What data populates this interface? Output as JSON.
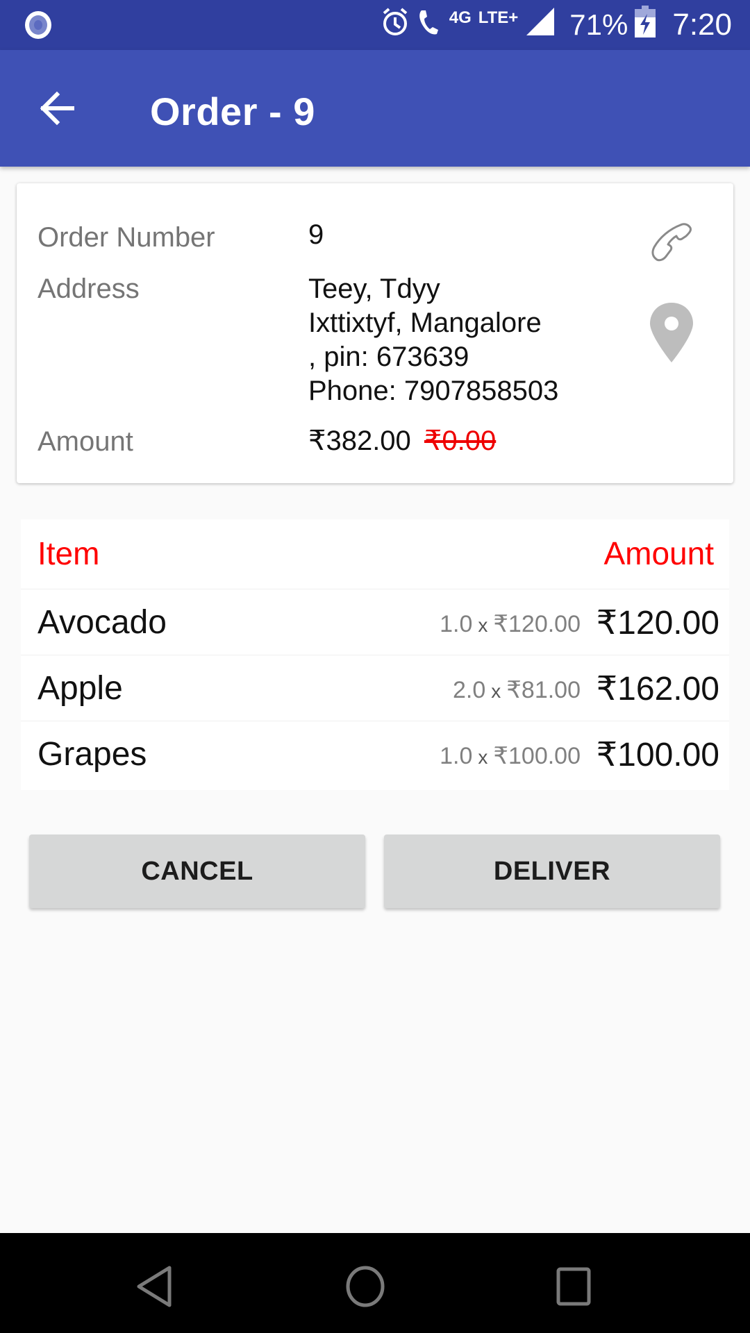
{
  "status_bar": {
    "network_label": "4G",
    "lte_label": "LTE+",
    "battery_percent": "71%",
    "time": "7:20"
  },
  "app_bar": {
    "title": "Order - 9",
    "back_icon": "arrow-left-icon"
  },
  "order": {
    "number_label": "Order Number",
    "number_value": "9",
    "address_label": "Address",
    "address_lines": [
      "Teey, Tdyy",
      "Ixttixtyf, Mangalore",
      ", pin: 673639",
      "Phone: 7907858503"
    ],
    "amount_label": "Amount",
    "amount_value": "₹382.00",
    "amount_struck": "₹0.00",
    "call_icon": "phone-icon",
    "location_icon": "map-pin-icon"
  },
  "items": {
    "header_item": "Item",
    "header_amount": "Amount",
    "rows": [
      {
        "name": "Avocado",
        "qty": "1.0",
        "x": "x",
        "unit_price": "₹120.00",
        "total": "₹120.00"
      },
      {
        "name": "Apple",
        "qty": "2.0",
        "x": "x",
        "unit_price": "₹81.00",
        "total": "₹162.00"
      },
      {
        "name": "Grapes",
        "qty": "1.0",
        "x": "x",
        "unit_price": "₹100.00",
        "total": "₹100.00"
      }
    ]
  },
  "actions": {
    "cancel_label": "CANCEL",
    "deliver_label": "DELIVER"
  },
  "colors": {
    "status_bar": "#303f9f",
    "app_bar": "#3f51b5",
    "accent_red": "#ff0000",
    "button_bg": "#d6d7d7"
  },
  "nav_bar": {
    "back": "nav-back-icon",
    "home": "nav-home-icon",
    "recents": "nav-recents-icon"
  }
}
